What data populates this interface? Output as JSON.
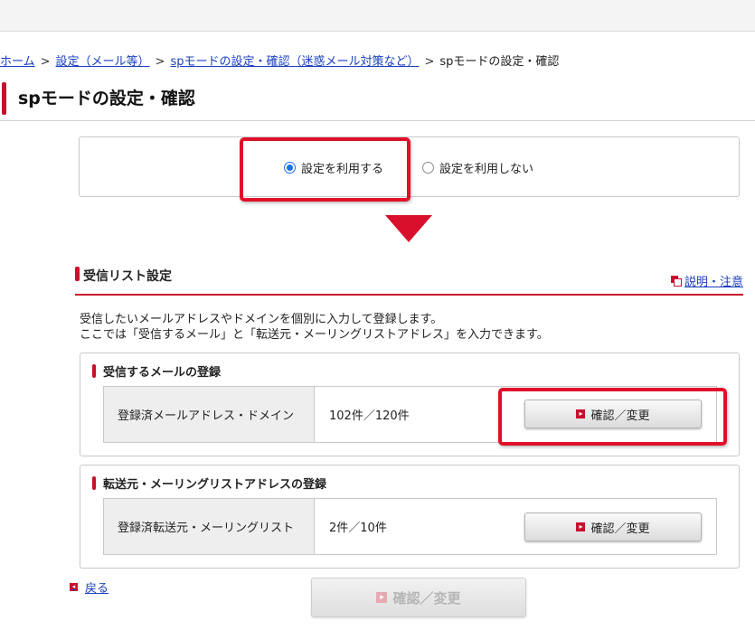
{
  "breadcrumb": {
    "items": [
      "ホーム",
      "設定（メール等）",
      "spモードの設定・確認（迷惑メール対策など）"
    ],
    "separator": ">",
    "current": "spモードの設定・確認"
  },
  "page": {
    "title": "spモードの設定・確認"
  },
  "radio_options": [
    {
      "label": "設定を利用する",
      "selected": true
    },
    {
      "label": "設定を利用しない",
      "selected": false
    }
  ],
  "section": {
    "title": "受信リスト設定",
    "help_link": "説明・注意",
    "description": [
      "受信したいメールアドレスやドメインを個別に入力して登録します。",
      "ここでは「受信するメール」と「転送元・メーリングリストアドレス」を入力できます。"
    ]
  },
  "cards": [
    {
      "title": "受信するメールの登録",
      "row_label": "登録済メールアドレス・ドメイン",
      "row_value": "102件／120件",
      "button": "確認／変更"
    },
    {
      "title": "転送元・メーリングリストアドレスの登録",
      "row_label": "登録済転送元・メーリングリスト",
      "row_value": "2件／10件",
      "button": "確認／変更"
    }
  ],
  "back_link": "戻る",
  "submit_button": {
    "label": "確認／変更",
    "enabled": false
  },
  "colors": {
    "accent": "#c8102e",
    "highlight": "#e0102a",
    "link": "#1a3fbf",
    "radio_selected": "#1a73e8"
  }
}
